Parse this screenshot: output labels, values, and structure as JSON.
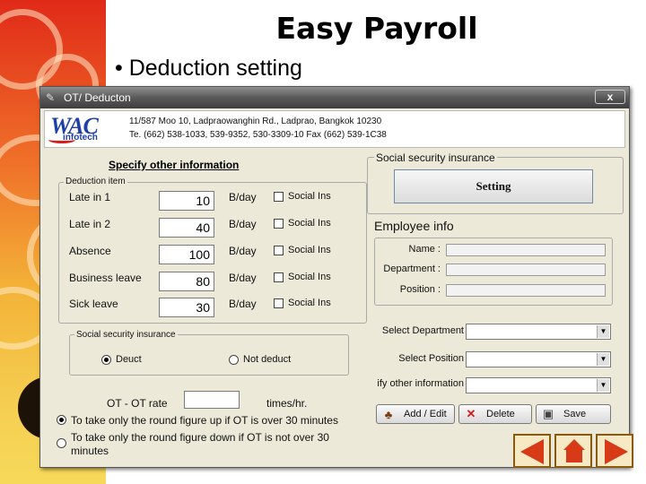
{
  "slide": {
    "title": "Easy Payroll",
    "bullet": "• Deduction setting"
  },
  "window": {
    "title": "OT/ Deducton",
    "close_label": "x"
  },
  "company": {
    "logo_main": "WAC",
    "logo_sub": "infotech",
    "address_line1": "11/587 Moo 10, Ladpraowanghin Rd., Ladprao, Bangkok 10230",
    "address_line2": "Te. (662) 538-1033, 539-9352, 530-3309-10 Fax (662) 539-1C38"
  },
  "specify": {
    "title": "Specify other information",
    "group_title": "Deduction item",
    "unit": "B/day",
    "social_label": "Social Ins",
    "items": [
      {
        "label": "Late in 1",
        "value": "10"
      },
      {
        "label": "Late in 2",
        "value": "40"
      },
      {
        "label": "Absence",
        "value": "100"
      },
      {
        "label": "Business leave",
        "value": "80"
      },
      {
        "label": "Sick leave",
        "value": "30"
      }
    ]
  },
  "social_group": {
    "title": "Social security insurance",
    "deduct_label": "Deuct",
    "not_deduct_label": "Not deduct",
    "selected": "deduct"
  },
  "ot": {
    "rate_label": "OT - OT rate",
    "rate_value": "",
    "unit": "times/hr.",
    "round_up_label": "To take only the round figure up if OT is over 30 minutes",
    "round_down_label": "To take only the round figure down if OT is not over 30 minutes",
    "selected": "up"
  },
  "ssi_panel": {
    "title": "Social security insurance",
    "setting_button": "Setting"
  },
  "employee": {
    "title": "Employee info",
    "name_label": "Name :",
    "department_label": "Department :",
    "position_label": "Position :",
    "name_value": "",
    "department_value": "",
    "position_value": ""
  },
  "selectors": {
    "department_label": "Select Department",
    "position_label": "Select Position",
    "other_label": "ify other information",
    "department_value": "",
    "position_value": "",
    "other_value": ""
  },
  "actions": {
    "add_edit": "Add / Edit",
    "delete": "Delete",
    "save": "Save"
  },
  "icons": {
    "app": "wrench-icon",
    "add": "people-icon",
    "delete": "x-mark-icon",
    "save": "floppy-icon"
  },
  "colors": {
    "titlebar": "#5a5a5a",
    "window_bg": "#ece9d8",
    "logo_blue": "#1f3fa8",
    "nav_red": "#d63a16"
  }
}
